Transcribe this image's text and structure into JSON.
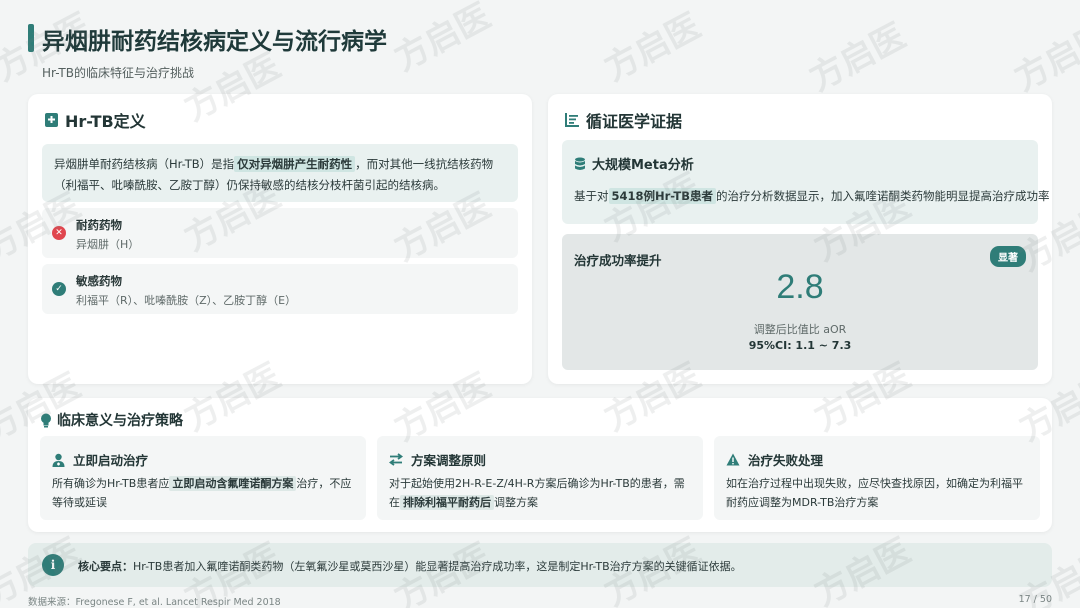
{
  "header": {
    "title": "异烟肼耐药结核病定义与流行病学",
    "subtitle": "Hr-TB的临床特征与治疗挑战"
  },
  "definition_card": {
    "title": "Hr-TB定义",
    "text_before": "异烟肼单耐药结核病（Hr-TB）是指",
    "highlight": "仅对异烟肼产生耐药性",
    "text_after": "，而对其他一线抗结核药物（利福平、吡嗪酰胺、乙胺丁醇）仍保持敏感的结核分枝杆菌引起的结核病。",
    "resistant": {
      "title": "耐药药物",
      "drugs": "异烟肼（H）"
    },
    "sensitive": {
      "title": "敏感药物",
      "drugs": "利福平（R）、吡嗪酰胺（Z）、乙胺丁醇（E）"
    }
  },
  "evidence_card": {
    "title": "循证医学证据",
    "meta_title": "大规模Meta分析",
    "meta_text_before": "基于对",
    "meta_highlight": "5418例Hr-TB患者",
    "meta_text_after": "的治疗分析数据显示，加入氟喹诺酮类药物能明显提高治疗成功率",
    "rate_title": "治疗成功率提升",
    "badge": "显著",
    "value": "2.8",
    "value_label": "调整后比值比 aOR",
    "ci": "95%CI: 1.1 ~ 7.3"
  },
  "strategy": {
    "title": "临床意义与治疗策略",
    "items": [
      {
        "title": "立即启动治疗",
        "text_before": "所有确诊为Hr-TB患者应",
        "highlight": "立即启动含氟喹诺酮方案",
        "text_after": "治疗，不应等待或延误"
      },
      {
        "title": "方案调整原则",
        "text_before": "对于起始使用2H-R-E-Z/4H-R方案后确诊为Hr-TB的患者，需在",
        "highlight": "排除利福平耐药后",
        "text_after": "调整方案"
      },
      {
        "title": "治疗失败处理",
        "text_before": "如在治疗过程中出现失败，应尽快查找原因，如确定为利福平耐药应调整为MDR-TB治疗方案",
        "highlight": "",
        "text_after": ""
      }
    ]
  },
  "key_point": {
    "label": "核心要点：",
    "text": "Hr-TB患者加入氟喹诺酮类药物（左氧氟沙星或莫西沙星）能显著提高治疗成功率，这是制定Hr-TB治疗方案的关键循证依据。"
  },
  "footer": {
    "source": "数据来源：Fregonese F, et al. Lancet Respir Med 2018",
    "page": "17 / 50"
  },
  "watermark": "方启医",
  "colors": {
    "accent": "#2f7d78",
    "danger": "#e0464e"
  }
}
